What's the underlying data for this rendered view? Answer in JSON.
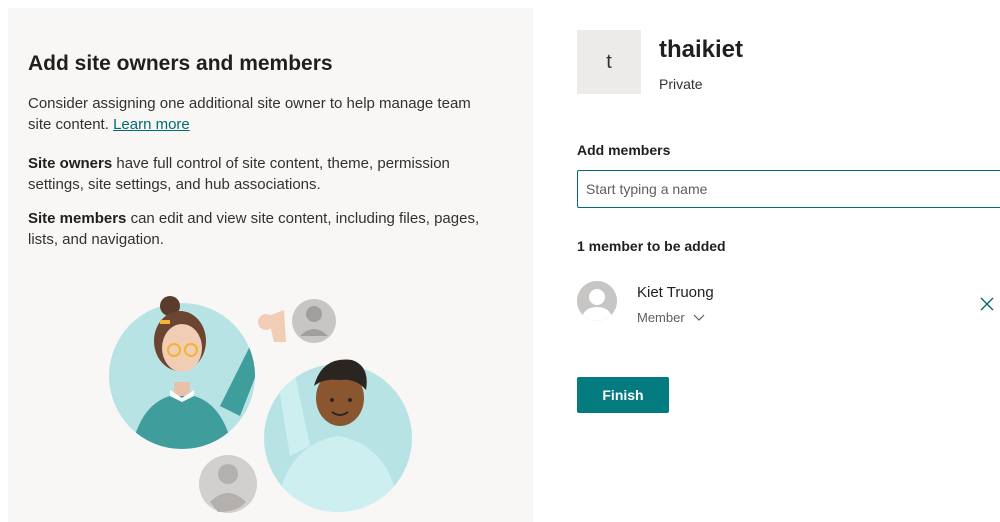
{
  "left_panel": {
    "title": "Add site owners and members",
    "intro_text": "Consider assigning one additional site owner to help manage team site content.",
    "learn_more": "Learn more",
    "owners_term": "Site owners",
    "owners_desc": "have full control of site content, theme, permission settings, site settings, and hub associations.",
    "members_term": "Site members",
    "members_desc": "can edit and view site content, including files, pages, lists, and navigation.",
    "illustration_icon": "people-high-five-illustration"
  },
  "site": {
    "initial": "t",
    "name": "thaikiet",
    "privacy": "Private"
  },
  "add_members": {
    "label": "Add members",
    "placeholder": "Start typing a name",
    "value": ""
  },
  "pending": {
    "count_label": "1 member to be added",
    "members": [
      {
        "name": "Kiet Truong",
        "role": "Member",
        "avatar_icon": "person-placeholder-icon",
        "remove_icon": "close-icon"
      }
    ]
  },
  "actions": {
    "finish_label": "Finish"
  },
  "colors": {
    "accent": "#037b7f",
    "panel_bg": "#f8f7f6",
    "site_tile": "#edebe9"
  }
}
